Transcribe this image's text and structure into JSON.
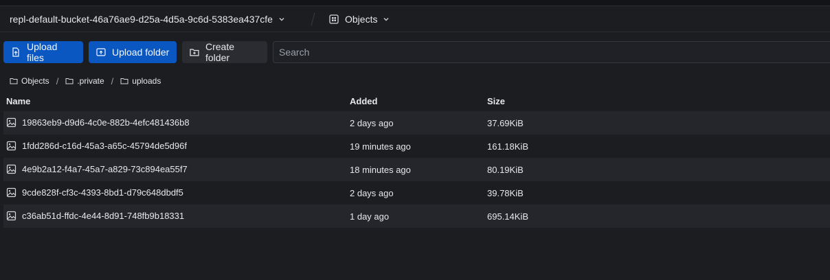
{
  "header": {
    "bucket_name": "repl-default-bucket-46a76ae9-d25a-4d5a-9c6d-5383ea437cfe",
    "view_label": "Objects"
  },
  "toolbar": {
    "upload_files_label": "Upload files",
    "upload_folder_label": "Upload folder",
    "create_folder_label": "Create folder",
    "search_placeholder": "Search"
  },
  "breadcrumb": [
    "Objects",
    ".private",
    "uploads"
  ],
  "table": {
    "columns": [
      "Name",
      "Added",
      "Size"
    ],
    "rows": [
      {
        "name": "19863eb9-d9d6-4c0e-882b-4efc481436b8",
        "added": "2 days ago",
        "size": "37.69KiB"
      },
      {
        "name": "1fdd286d-c16d-45a3-a65c-45794de5d96f",
        "added": "19 minutes ago",
        "size": "161.18KiB"
      },
      {
        "name": "4e9b2a12-f4a7-45a7-a829-73c894ea55f7",
        "added": "18 minutes ago",
        "size": "80.19KiB"
      },
      {
        "name": "9cde828f-cf3c-4393-8bd1-d79c648dbdf5",
        "added": "2 days ago",
        "size": "39.78KiB"
      },
      {
        "name": "c36ab51d-ffdc-4e44-8d91-748fb9b18331",
        "added": "1 day ago",
        "size": "695.14KiB"
      }
    ]
  },
  "colors": {
    "background": "#1c1d21",
    "primary_button": "#0b57c1",
    "row_alt": "#24262b"
  },
  "icons": {
    "bucket_dropdown": "chevron-down-icon",
    "view_icon": "objects-grid-icon",
    "upload_files": "file-upload-icon",
    "upload_folder": "folder-upload-icon",
    "create_folder": "folder-plus-icon",
    "crumb": "folder-icon",
    "row": "image-icon"
  }
}
